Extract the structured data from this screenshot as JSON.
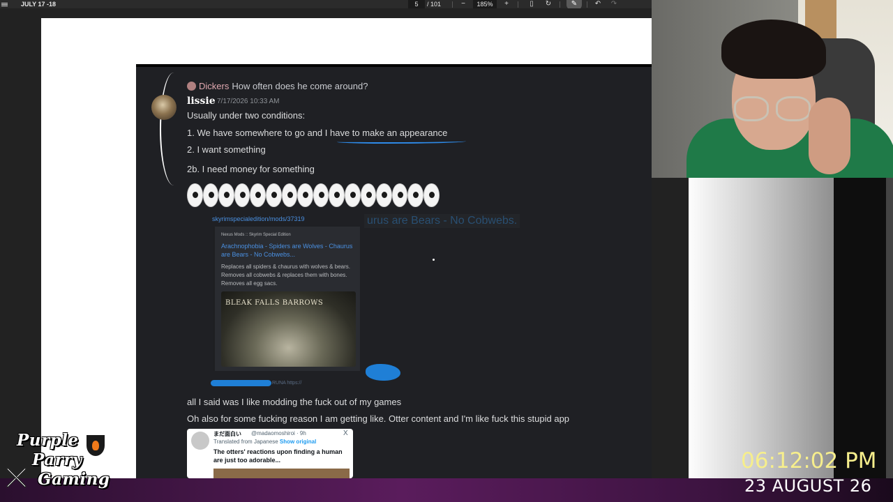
{
  "toolbar": {
    "doc_title": "JULY 17 -18",
    "page_current": "5",
    "page_total": "/ 101",
    "zoom_minus": "−",
    "zoom_value": "185%",
    "zoom_plus": "+",
    "icons": [
      "menu-icon",
      "fit-page-icon",
      "rotate-icon",
      "draw-icon",
      "undo-icon",
      "redo-icon"
    ]
  },
  "discord": {
    "reply_author": "Dickers",
    "reply_text": "How often does he come around?",
    "author": "lissie",
    "timestamp": "7/17/2026 10:33 AM",
    "lines": [
      "Usually under two conditions:",
      "1. We have somewhere to go and I have to make an appearance",
      "2. I want something",
      "2b. I need money for something"
    ],
    "eye_emoji_count": 16,
    "embed": {
      "url": "skyrimspecialedition/mods/37319",
      "ghost_title": "urus are Bears - No Cobwebs.",
      "provider": "Nexus Mods :: Skyrim Special Edition",
      "title": "Arachnophobia - Spiders are Wolves - Chaurus are Bears - No Cobwebs...",
      "description": "Replaces all spiders & chaurus with wolves & bears. Removes all cobwebs & replaces them with bones. Removes all egg sacs.",
      "thumbnail_text": "BLEAK FALLS BARROWS",
      "partial_link": "RUNA   https://"
    },
    "after_lines": [
      "all I said was I like modding the fuck out of my games",
      "Oh also for some fucking reason I am getting like. Otter content and I'm like fuck this stupid app"
    ],
    "tweet": {
      "name": "まだ面白い",
      "handle": "@madaomoshiroi · 9h",
      "close": "X",
      "translated": "Translated from Japanese",
      "show_original": "Show original",
      "body": "The otters' reactions upon finding a human are just too adorable..."
    }
  },
  "overlay": {
    "logo_lines": [
      "Purple",
      "Parry",
      "Gaming"
    ],
    "clock_time": "06:12:02 PM",
    "clock_date": "23 AUGUST 26"
  },
  "colors": {
    "accent_blue": "#2e8bea",
    "clock_yellow": "#f6ee8c",
    "discord_bg": "#1f2024"
  }
}
